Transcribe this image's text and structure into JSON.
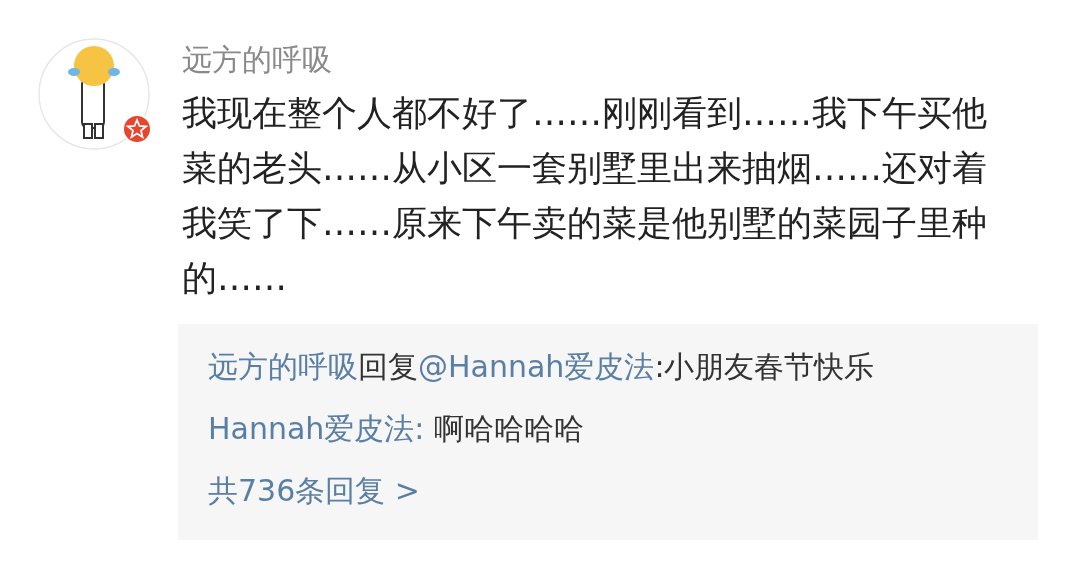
{
  "comment": {
    "author": "远方的呼吸",
    "verified": true,
    "text": "我现在整个人都不好了……刚刚看到……我下午买他菜的老头……从小区一套别墅里出来抽烟……还对着我笑了下……原来下午卖的菜是他别墅的菜园子里种的……"
  },
  "replies": [
    {
      "segments": [
        {
          "kind": "link",
          "text": "远方的呼吸"
        },
        {
          "kind": "text",
          "text": "回复"
        },
        {
          "kind": "link",
          "text": "@Hannah爱皮法"
        },
        {
          "kind": "text",
          "text": ":小朋友春节快乐"
        }
      ]
    },
    {
      "segments": [
        {
          "kind": "link",
          "text": "Hannah爱皮法:"
        },
        {
          "kind": "text",
          "text": " 啊哈哈哈哈"
        }
      ]
    }
  ],
  "more_replies": "共736条回复 >"
}
